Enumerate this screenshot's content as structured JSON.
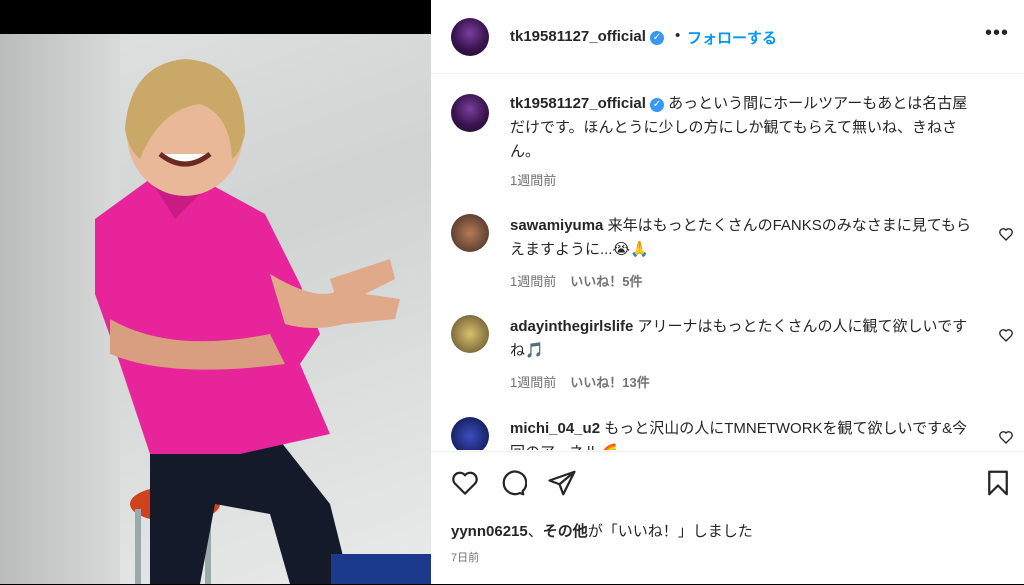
{
  "post": {
    "username": "tk19581127_official",
    "follow_label": "フォローする",
    "dot": "•",
    "more_label": "•••",
    "caption": "あっという間にホールツアーもあとは名古屋だけです。ほんとうに少しの方にしか観てもらえて無いね、きねさん。",
    "caption_time": "1週間前"
  },
  "comments": [
    {
      "user": "sawamiyuma",
      "text": "来年はもっとたくさんのFANKSのみなさまに見てもらえますように...😭🙏",
      "time": "1週間前",
      "likes": "いいね！5件"
    },
    {
      "user": "adayinthegirlslife",
      "text": "アリーナはもっとたくさんの人に観て欲しいですね🎵",
      "time": "1週間前",
      "likes": "いいね！13件"
    },
    {
      "user": "michi_04_u2",
      "text": "もっと沢山の人にTMNETWORKを観て欲しいです&今回のアーネル🌈",
      "time": "",
      "likes": ""
    }
  ],
  "footer": {
    "liker": "yynn06215",
    "liked_suffix_1": "、",
    "others": "その他",
    "liked_suffix_2": "が「いいね！」しました",
    "date": "7日前"
  },
  "colors": {
    "accent": "#0095f6",
    "verified": "#3897f0",
    "shirt": "#e8249a"
  }
}
